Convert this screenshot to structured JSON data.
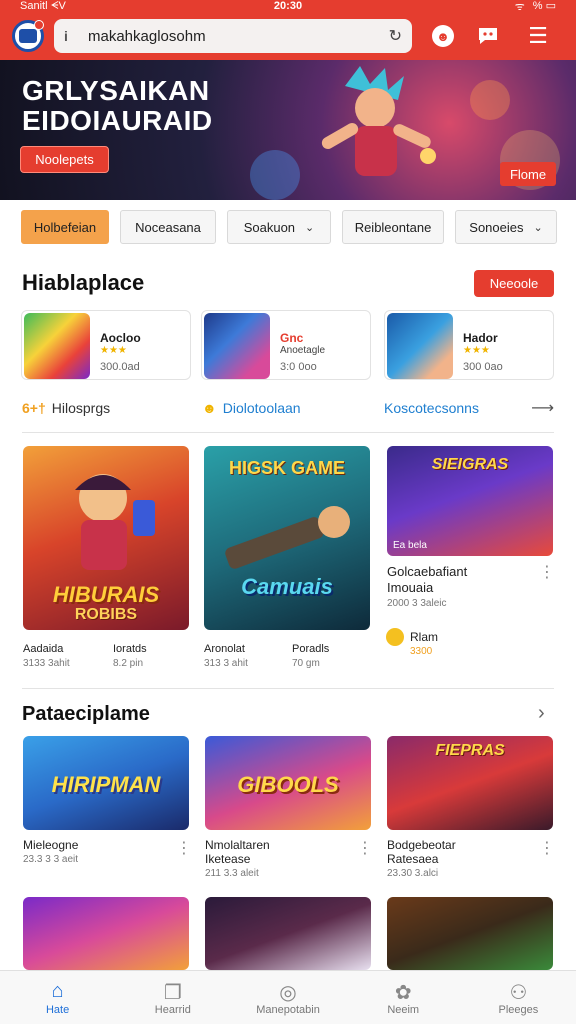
{
  "status": {
    "carrier": "Sanitl ᗕV",
    "time": "20:30",
    "battery": "% ▭"
  },
  "toolbar": {
    "url": "makahkaglosohm",
    "info_icon": "i",
    "reload_icon": "↻"
  },
  "hero": {
    "title_line1": "GRLYSAIKAN",
    "title_line2": "EIDOIAURAID",
    "cta_label": "Noolepets",
    "corner_label": "Flome"
  },
  "chips": [
    {
      "label": "Holbefeian",
      "active": true,
      "caret": false
    },
    {
      "label": "Noceasana",
      "active": false,
      "caret": false
    },
    {
      "label": "Soakuon",
      "active": false,
      "caret": true
    },
    {
      "label": "Reibleontane",
      "active": false,
      "caret": false
    },
    {
      "label": "Sonoeies",
      "active": false,
      "caret": true
    }
  ],
  "featured": {
    "title": "Hiablaplace",
    "button": "Neeoole",
    "cards": [
      {
        "name": "Aocloo",
        "stars": "★★★",
        "meta": "300.0ad"
      },
      {
        "name": "Gnc",
        "stars": "Anoetagle",
        "meta": "3:0 0oo"
      },
      {
        "name": "Hador",
        "stars": "★★★",
        "meta": "300 0ao"
      }
    ]
  },
  "filters": {
    "f1_icon": "6+†",
    "f1": "Hilosprgs",
    "f2_icon": "☻",
    "f2": "Diolotoolaan",
    "f3": "Koscotecsonns",
    "arrow": "⟶"
  },
  "grid": {
    "card1": {
      "label": "HIBURAIS",
      "sub": "ROBIBS"
    },
    "card2": {
      "label": "Camuais",
      "sub": "HIGSK GAME"
    },
    "card3": {
      "label": "SIEIGRAS",
      "sub": "Ea bela"
    },
    "captions": [
      {
        "title": "Aadaida",
        "meta": "3133 3ahit"
      },
      {
        "title": "Ioratds",
        "meta": "8.2 pin"
      },
      {
        "title": "Aronolat",
        "meta": "313 3 ahit"
      },
      {
        "title": "Poradls",
        "meta": "70 gm"
      }
    ],
    "side": {
      "title1": "Golcaebafiant",
      "title2": "Imouaia",
      "meta": "2000 3 3aleic",
      "extra_title": "Rlam",
      "extra_meta": "3300"
    }
  },
  "section2": {
    "title": "Pataeciplame",
    "items": [
      {
        "label": "HIRIPMAN",
        "title": "Mieleogne",
        "meta": "23.3 3 3 aeit"
      },
      {
        "label": "GIBOOLS",
        "title": "Nmolaltaren",
        "title2": "Iketease",
        "meta": "211 3.3 aleit"
      },
      {
        "label": "FIEPRAS",
        "title": "Bodgebeotar",
        "title2": "Ratesaea",
        "meta": "23.30 3.alci"
      }
    ]
  },
  "bottom_nav": [
    {
      "label": "Hate",
      "icon": "⌂",
      "active": true
    },
    {
      "label": "Hearrid",
      "icon": "❐",
      "active": false
    },
    {
      "label": "Manepotabin",
      "icon": "◎",
      "active": false
    },
    {
      "label": "Neeim",
      "icon": "✿",
      "active": false
    },
    {
      "label": "Pleeges",
      "icon": "⚇",
      "active": false
    }
  ]
}
